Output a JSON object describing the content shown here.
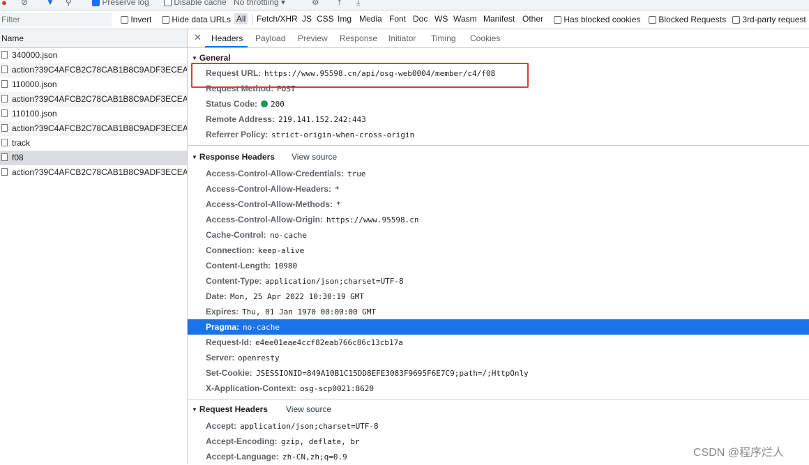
{
  "toolbar": {
    "preserve_log": "Preserve log",
    "disable_cache": "Disable cache",
    "throttling": "No throttling"
  },
  "filterbar": {
    "filter_placeholder": "Filter",
    "invert": "Invert",
    "hide_data_urls": "Hide data URLs",
    "types": [
      "All",
      "Fetch/XHR",
      "JS",
      "CSS",
      "Img",
      "Media",
      "Font",
      "Doc",
      "WS",
      "Wasm",
      "Manifest",
      "Other"
    ],
    "has_blocked_cookies": "Has blocked cookies",
    "blocked_requests": "Blocked Requests",
    "third_party": "3rd-party request"
  },
  "request_list": {
    "header": "Name",
    "rows": [
      "340000.json",
      "action?39C4AFCB2C78CAB1B8C9ADF3ECEA...",
      "110000.json",
      "action?39C4AFCB2C78CAB1B8C9ADF3ECEA...",
      "110100.json",
      "action?39C4AFCB2C78CAB1B8C9ADF3ECEA...",
      "track",
      "f08",
      "action?39C4AFCB2C78CAB1B8C9ADF3ECEA..."
    ]
  },
  "tabs": [
    "Headers",
    "Payload",
    "Preview",
    "Response",
    "Initiator",
    "Timing",
    "Cookies"
  ],
  "general": {
    "title": "General",
    "rows": [
      {
        "k": "Request URL:",
        "v": "https://www.95598.cn/api/osg-web0004/member/c4/f08"
      },
      {
        "k": "Request Method:",
        "v": "POST"
      },
      {
        "k": "Status Code:",
        "v": "200"
      },
      {
        "k": "Remote Address:",
        "v": "219.141.152.242:443"
      },
      {
        "k": "Referrer Policy:",
        "v": "strict-origin-when-cross-origin"
      }
    ]
  },
  "response_headers": {
    "title": "Response Headers",
    "view_source": "View source",
    "rows": [
      {
        "k": "Access-Control-Allow-Credentials:",
        "v": "true"
      },
      {
        "k": "Access-Control-Allow-Headers:",
        "v": "*"
      },
      {
        "k": "Access-Control-Allow-Methods:",
        "v": "*"
      },
      {
        "k": "Access-Control-Allow-Origin:",
        "v": "https://www.95598.cn"
      },
      {
        "k": "Cache-Control:",
        "v": "no-cache"
      },
      {
        "k": "Connection:",
        "v": "keep-alive"
      },
      {
        "k": "Content-Length:",
        "v": "10980"
      },
      {
        "k": "Content-Type:",
        "v": "application/json;charset=UTF-8"
      },
      {
        "k": "Date:",
        "v": "Mon, 25 Apr 2022 10:30:19 GMT"
      },
      {
        "k": "Expires:",
        "v": "Thu, 01 Jan 1970 00:00:00 GMT"
      },
      {
        "k": "Pragma:",
        "v": "no-cache"
      },
      {
        "k": "Request-Id:",
        "v": "e4ee01eae4ccf82eab766c86c13cb17a"
      },
      {
        "k": "Server:",
        "v": "openresty"
      },
      {
        "k": "Set-Cookie:",
        "v": "JSESSIONID=849A10B1C15DD8EFE3083F9695F6E7C9;path=/;HttpOnly"
      },
      {
        "k": "X-Application-Context:",
        "v": "osg-scp0021:8620"
      }
    ]
  },
  "request_headers": {
    "title": "Request Headers",
    "view_source": "View source",
    "rows": [
      {
        "k": "Accept:",
        "v": "application/json;charset=UTF-8"
      },
      {
        "k": "Accept-Encoding:",
        "v": "gzip, deflate, br"
      },
      {
        "k": "Accept-Language:",
        "v": "zh-CN,zh;q=0.9"
      }
    ]
  },
  "watermark": "CSDN @程序烂人",
  "colors": {
    "accent": "#1a73e8",
    "annotation": "#e53935",
    "status_ok": "#0f9d58"
  }
}
